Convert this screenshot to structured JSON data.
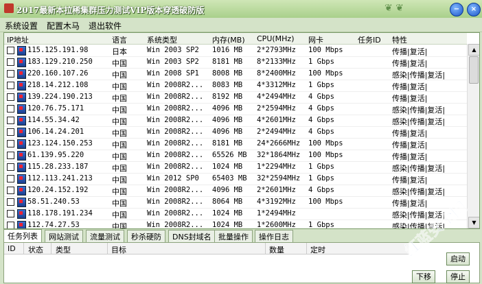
{
  "window": {
    "title": "2017最新本拉稀集群压力测试VIP版本穿透破防版",
    "min": "−",
    "close": "×"
  },
  "menu": [
    "系统设置",
    "配置木马",
    "退出软件"
  ],
  "columns": [
    "IP地址",
    "语言",
    "系统类型",
    "内存(MB)",
    "CPU(MHz)",
    "网卡",
    "任务ID",
    "特性"
  ],
  "rows": [
    [
      "115.125.191.98",
      "日本",
      "Win 2003 SP2",
      "1016 MB",
      "2*2793MHz",
      "100 Mbps",
      "",
      "传播|复活|"
    ],
    [
      "183.129.210.250",
      "中国",
      "Win 2003 SP2",
      "8181 MB",
      "8*2133MHz",
      "1 Gbps",
      "",
      "传播|复活|"
    ],
    [
      "220.160.107.26",
      "中国",
      "Win 2008 SP1",
      "8008 MB",
      "8*2400MHz",
      "100 Mbps",
      "",
      "感染|传播|复活|"
    ],
    [
      "218.14.212.108",
      "中国",
      "Win 2008R2...",
      "8083 MB",
      "4*3312MHz",
      "1 Gbps",
      "",
      "传播|复活|"
    ],
    [
      "139.224.190.213",
      "中国",
      "Win 2008R2...",
      "8192 MB",
      "4*2494MHz",
      "4 Gbps",
      "",
      "传播|复活|"
    ],
    [
      "120.76.75.171",
      "中国",
      "Win 2008R2...",
      "4096 MB",
      "2*2594MHz",
      "4 Gbps",
      "",
      "感染|传播|复活|"
    ],
    [
      "114.55.34.42",
      "中国",
      "Win 2008R2...",
      "4096 MB",
      "4*2601MHz",
      "4 Gbps",
      "",
      "感染|传播|复活|"
    ],
    [
      "106.14.24.201",
      "中国",
      "Win 2008R2...",
      "4096 MB",
      "2*2494MHz",
      "4 Gbps",
      "",
      "传播|复活|"
    ],
    [
      "123.124.150.253",
      "中国",
      "Win 2008R2...",
      "8181 MB",
      "24*2666MHz",
      "100 Mbps",
      "",
      "传播|复活|"
    ],
    [
      "61.139.95.220",
      "中国",
      "Win 2008R2...",
      "65526 MB",
      "32*1864MHz",
      "100 Mbps",
      "",
      "传播|复活|"
    ],
    [
      "115.28.233.187",
      "中国",
      "Win 2008R2...",
      "1024 MB",
      "1*2294MHz",
      "1 Gbps",
      "",
      "感染|传播|复活|"
    ],
    [
      "112.113.241.213",
      "中国",
      "Win 2012 SP0",
      "65403 MB",
      "32*2594MHz",
      "1 Gbps",
      "",
      "传播|复活|"
    ],
    [
      "120.24.152.192",
      "中国",
      "Win 2008R2...",
      "4096 MB",
      "2*2601MHz",
      "4 Gbps",
      "",
      "感染|传播|复活|"
    ],
    [
      "58.51.240.53",
      "中国",
      "Win 2008R2...",
      "8064 MB",
      "4*3192MHz",
      "100 Mbps",
      "",
      "传播|复活|"
    ],
    [
      "118.178.191.234",
      "中国",
      "Win 2008R2...",
      "1024 MB",
      "1*2494MHz",
      "",
      "",
      "感染|传播|复活|"
    ],
    [
      "112.74.27.53",
      "中国",
      "Win 2008R2...",
      "1024 MB",
      "1*2600MHz",
      "1 Gbps",
      "",
      "感染|传播|复活|"
    ]
  ],
  "tabs": [
    "任务列表",
    "网站测试",
    "流量测试",
    "秒杀硬防",
    "DNS封域名",
    "批量操作",
    "操作日志"
  ],
  "task_columns": [
    "ID",
    "状态",
    "类型",
    "目标",
    "数量",
    "定时"
  ],
  "buttons": {
    "start": "启动",
    "move": "下移",
    "stop": "停止"
  },
  "watermark": "红蓝安全网"
}
